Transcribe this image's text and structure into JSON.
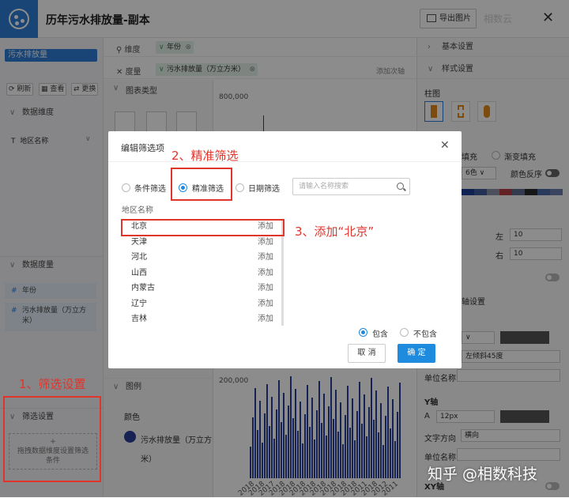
{
  "header": {
    "title": "历年污水排放量-副本",
    "export_label": "导出图片",
    "watermark": "相数云"
  },
  "left": {
    "dataset": "污水排放量",
    "toolbar": [
      "刷新",
      "查看",
      "更换"
    ],
    "dimension_section": "数据维度",
    "dimension_field": "地区名称",
    "measure_section": "数据度量",
    "measures": [
      "年份",
      "污水排放量（万立方米）"
    ],
    "filter_section": "筛选设置",
    "filter_drop_plus": "+",
    "filter_drop_text": "拖拽数据维度设置筛选条件"
  },
  "shelves": {
    "dim_label": "维度",
    "dim_value": "年份",
    "measure_label": "度量",
    "measure_value": "污水排放量（万立方米）",
    "add_axis": "添加次轴"
  },
  "chart_panel": {
    "type_header": "图表类型",
    "legend_header": "图例",
    "color_label": "颜色",
    "legend_item": "污水排放量（万立方米）"
  },
  "chart_data": {
    "type": "bar",
    "y_ticks": [
      "800,000",
      "200,000"
    ],
    "x_ticks": [
      "2018",
      "2018",
      "2017",
      "2018",
      "2018",
      "2018",
      "2018",
      "2018",
      "2018",
      "2018",
      "2018",
      "2011",
      "2018",
      "2012",
      "2011"
    ]
  },
  "right": {
    "basic": "基本设置",
    "style": "样式设置",
    "bar_label": "柱图",
    "fill_label": "填充",
    "gradient_label": "渐变填充",
    "color_scheme": "6色",
    "color_reverse": "颜色反序",
    "palette": [
      "#1c3f95",
      "#3e5a9a",
      "#8b93a8",
      "#b54142",
      "#5c6d8f",
      "#2a2a2a",
      "#4d6ba8",
      "#6d7fb0"
    ],
    "left_label": "左",
    "left_value": "10",
    "right_label": "右",
    "right_value": "10",
    "axis_section": "轴设置",
    "tilt": "左倾斜45度",
    "unit_name": "单位名称",
    "y_axis": "Y轴",
    "font_a": "A",
    "font_size": "12px",
    "text_dir_label": "文字方向",
    "text_dir_value": "横向",
    "unit_name2": "单位名称",
    "xy_axis": "XY轴"
  },
  "dialog": {
    "title": "编辑筛选项",
    "modes": [
      "条件筛选",
      "精准筛选",
      "日期筛选"
    ],
    "search_placeholder": "请输入名称搜索",
    "field": "地区名称",
    "items": [
      "北京",
      "天津",
      "河北",
      "山西",
      "内蒙古",
      "辽宁",
      "吉林"
    ],
    "add_label": "添加",
    "include": "包含",
    "exclude": "不包含",
    "cancel": "取 消",
    "ok": "确 定"
  },
  "annotations": {
    "a1": "1、筛选设置",
    "a2": "2、精准筛选",
    "a3": "3、添加“北京”"
  },
  "watermark2": "知乎 @相数科技"
}
